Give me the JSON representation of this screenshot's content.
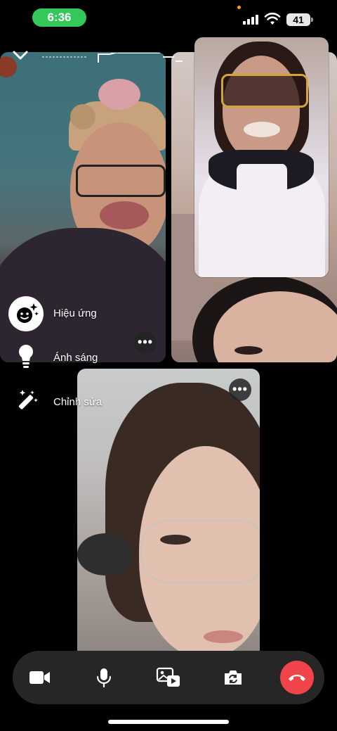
{
  "status_bar": {
    "time": "6:36",
    "battery": "41",
    "time_pill_color": "#34c759"
  },
  "participants": [
    {
      "tile": "participant-tile-1",
      "effect": "bunny-headband"
    },
    {
      "tile": "participant-tile-2"
    },
    {
      "tile": "participant-tile-3",
      "effect": "sunglasses-filter"
    },
    {
      "tile": "self-view-tile"
    }
  ],
  "effects_menu": {
    "items": [
      {
        "label": "Hiệu ứng",
        "icon": "effects-face-icon"
      },
      {
        "label": "Ánh sáng",
        "icon": "lightbulb-icon"
      },
      {
        "label": "Chỉnh sửa",
        "icon": "magic-wand-icon"
      }
    ]
  },
  "controls": {
    "buttons": [
      {
        "name": "video-camera-button",
        "icon": "video-camera-icon"
      },
      {
        "name": "microphone-button",
        "icon": "microphone-icon"
      },
      {
        "name": "share-media-button",
        "icon": "media-share-icon"
      },
      {
        "name": "flip-camera-button",
        "icon": "flip-camera-icon"
      },
      {
        "name": "end-call-button",
        "icon": "phone-hangup-icon"
      }
    ],
    "end_call_color": "#f0434a",
    "bar_color": "#262626"
  },
  "more_button": {
    "label": "•••"
  }
}
